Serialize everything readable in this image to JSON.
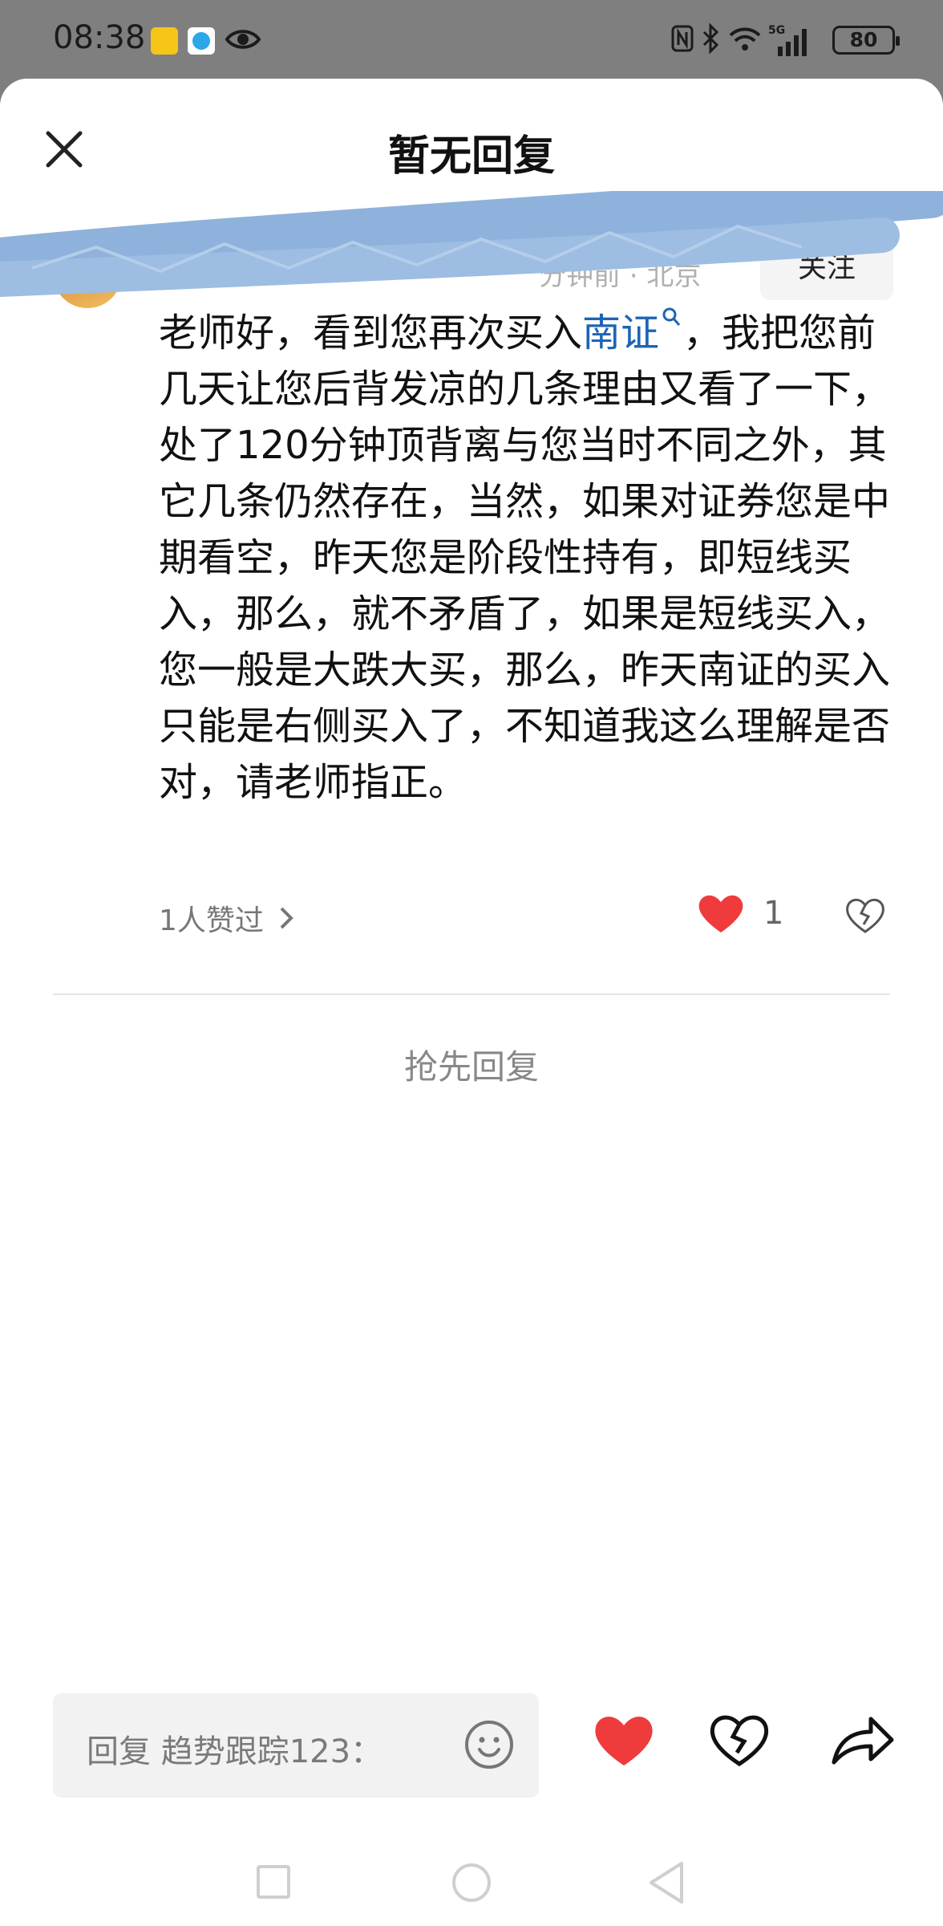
{
  "status_bar": {
    "time": "08:38",
    "app_icon_meituan": "美团",
    "battery": "80",
    "network": "5G"
  },
  "sheet": {
    "title": "暂无回复",
    "follow_label": "关注",
    "time_location": "分钟前 · 北京"
  },
  "comment": {
    "text_before_link": "老师好，看到您再次买入",
    "stock_link": "南证",
    "text_after_link": "，我把您前几天让您后背发凉的几条理由又看了一下，处了120分钟顶背离与您当时不同之外，其它几条仍然存在，当然，如果对证券您是中期看空，昨天您是阶段性持有，即短线买入，那么，就不矛盾了，如果是短线买入，您一般是大跌大买，那么，昨天南证的买入只能是右侧买入了，不知道我这么理解是否对，请老师指正。",
    "likes_summary": "1人赞过",
    "like_count": "1"
  },
  "reply_first": "抢先回复",
  "bottom_bar": {
    "reply_placeholder": "回复 趋势跟踪123："
  },
  "colors": {
    "status_bar_bg": "#7f7f7f",
    "link_blue": "#1e64b4",
    "like_red": "#ef3b3b",
    "redaction_blue": "#8fb2dc"
  },
  "icons": [
    "close-icon",
    "search-icon",
    "heart-icon",
    "broken-heart-icon",
    "chevron-right-icon",
    "emoji-icon",
    "share-icon"
  ]
}
